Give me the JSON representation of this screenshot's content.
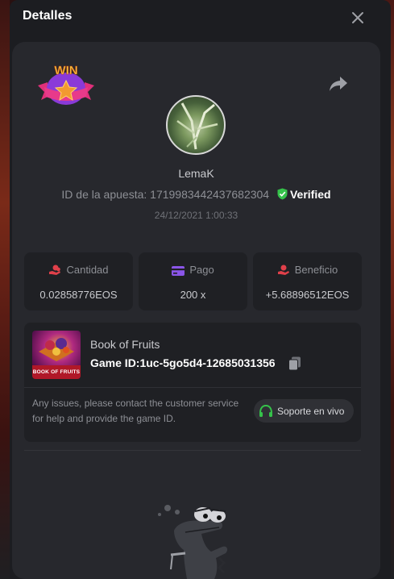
{
  "header": {
    "title": "Detalles",
    "close_icon": "close-icon"
  },
  "bet": {
    "badge_text": "WIN",
    "username": "LemaK",
    "bet_id_label": "ID de la apuesta:",
    "bet_id": "1719983442437682304",
    "verified_label": "Verified",
    "datetime": "24/12/2021 1:00:33"
  },
  "stats": [
    {
      "label": "Cantidad",
      "value": "0.02858776EOS",
      "icon": "coins-hand-icon",
      "color": "#e0404a"
    },
    {
      "label": "Pago",
      "value": "200 x",
      "icon": "card-icon",
      "color": "#8a55e8"
    },
    {
      "label": "Beneficio",
      "value": "+5.68896512EOS",
      "icon": "profit-hand-icon",
      "color": "#e0404a"
    }
  ],
  "game": {
    "name": "Book of Fruits",
    "thumb_label": "BOOK OF FRUITS",
    "id_label": "Game ID:",
    "id_value": "1uc-5go5d4-12685031356",
    "support_text": "Any issues, please contact the customer service for help and provide the game ID.",
    "support_button": "Soporte en vivo"
  },
  "colors": {
    "accent_green": "#35c24a",
    "card_bg": "#27282d",
    "modal_bg": "#1c1d21"
  }
}
